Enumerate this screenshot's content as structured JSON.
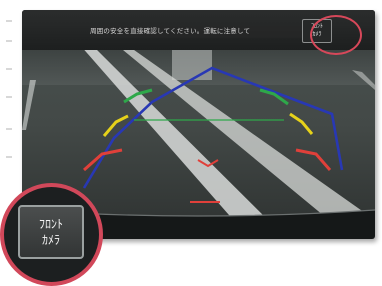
{
  "camera_view": {
    "caption": "周囲の安全を直接確認してください。運転に注意して",
    "button_label_line1": "ﾌﾛﾝﾄ",
    "button_label_line2": "ｶﾒﾗ"
  },
  "zoom_callout": {
    "button_label_line1": "ﾌﾛﾝﾄ",
    "button_label_line2": "ｶﾒﾗ"
  },
  "colors": {
    "highlight_ring": "#d1485a",
    "guide_red": "#e0403a",
    "guide_yellow": "#e6d21a",
    "guide_green": "#2ea84a",
    "guide_blue": "#2838b4"
  }
}
